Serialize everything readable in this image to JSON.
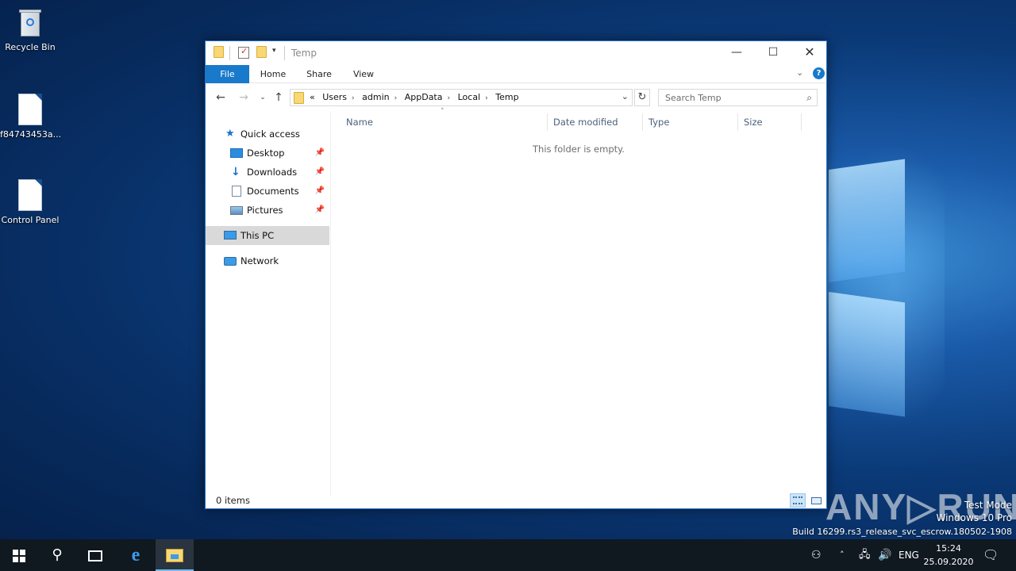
{
  "desktop": {
    "icons": [
      {
        "label": "Recycle Bin",
        "icon": "recycle-bin-icon"
      },
      {
        "label": "f84743453a...",
        "icon": "file-icon"
      },
      {
        "label": "Control Panel",
        "icon": "file-icon"
      }
    ]
  },
  "window": {
    "title": "Temp",
    "controls": {
      "minimize": "—",
      "maximize": "☐",
      "close": "✕"
    },
    "ribbon": {
      "tabs": [
        "File",
        "Home",
        "Share",
        "View"
      ],
      "help": "?"
    },
    "address": {
      "overflow": "«",
      "crumbs": [
        "Users",
        "admin",
        "AppData",
        "Local",
        "Temp"
      ],
      "search_placeholder": "Search Temp"
    },
    "nav": {
      "quick_access": "Quick access",
      "items": [
        {
          "label": "Desktop",
          "pinned": true
        },
        {
          "label": "Downloads",
          "pinned": true
        },
        {
          "label": "Documents",
          "pinned": true
        },
        {
          "label": "Pictures",
          "pinned": true
        }
      ],
      "this_pc": "This PC",
      "network": "Network"
    },
    "columns": [
      "Name",
      "Date modified",
      "Type",
      "Size"
    ],
    "empty_message": "This folder is empty.",
    "status": {
      "items": "0 items"
    }
  },
  "watermark": {
    "brand": "ANY▷RUN",
    "mode": "Test Mode",
    "edition": "Windows 10 Pro",
    "build": "Build 16299.rs3_release_svc_escrow.180502-1908"
  },
  "taskbar": {
    "language": "ENG",
    "time": "15:24",
    "date": "25.09.2020"
  },
  "colors": {
    "accent": "#1979ca",
    "selection": "#d9d9d9",
    "taskbar": "#101820"
  }
}
